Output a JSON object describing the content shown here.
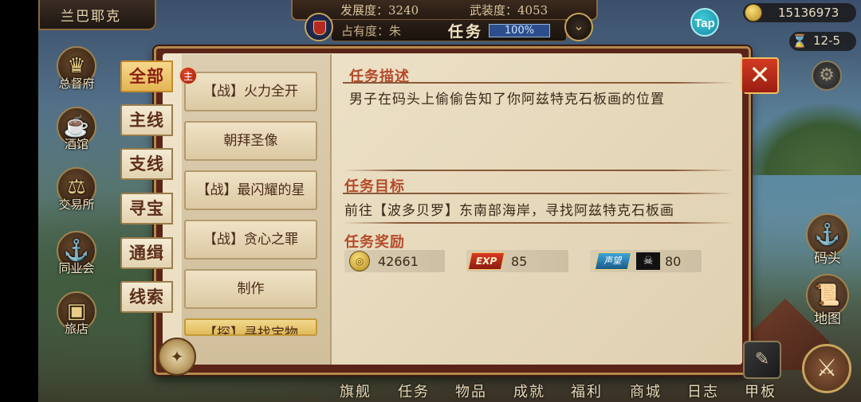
{
  "header": {
    "city_name": "兰巴耶克",
    "development": "发展度：3240",
    "armament": "武装度：4053",
    "occupancy": "占有度：朱",
    "title": "任务",
    "progress": "100%"
  },
  "currency": {
    "tap_label": "Tap",
    "gold": "15136973",
    "date": "12-5"
  },
  "city_menu_left": [
    {
      "label": "总督府",
      "icon": "governor-crown-icon"
    },
    {
      "label": "酒馆",
      "icon": "tavern-mug-icon"
    },
    {
      "label": "交易所",
      "icon": "scales-icon"
    },
    {
      "label": "同业会",
      "icon": "guild-anchor-icon"
    },
    {
      "label": "旅店",
      "icon": "inn-bag-icon"
    }
  ],
  "city_menu_right": [
    {
      "label": "码头",
      "icon": "dock-icon"
    },
    {
      "label": "地图",
      "icon": "scroll-map-icon"
    }
  ],
  "categories": [
    "全部",
    "主线",
    "支线",
    "寻宝",
    "通缉",
    "线索"
  ],
  "active_category": "全部",
  "quests": [
    {
      "label": "【战】火力全开",
      "badge": "主"
    },
    {
      "label": "朝拜圣像"
    },
    {
      "label": "【战】最闪耀的星"
    },
    {
      "label": "【战】贪心之罪"
    },
    {
      "label": "制作"
    },
    {
      "label": "【探】寻找宝物"
    }
  ],
  "detail": {
    "desc_title": "任务描述",
    "desc_text": "男子在码头上偷偷告知了你阿兹特克石板画的位置",
    "goal_title": "任务目标",
    "goal_text": "前往【波多贝罗】东南部海岸，寻找阿兹特克石板画",
    "reward_title": "任务奖励",
    "rewards": {
      "gold": "42661",
      "exp_label": "EXP",
      "exp": "85",
      "fame_label": "声望",
      "fame": "80"
    }
  },
  "bottom_nav": [
    "旗舰",
    "任务",
    "物品",
    "成就",
    "福利",
    "商城",
    "日志",
    "甲板"
  ]
}
